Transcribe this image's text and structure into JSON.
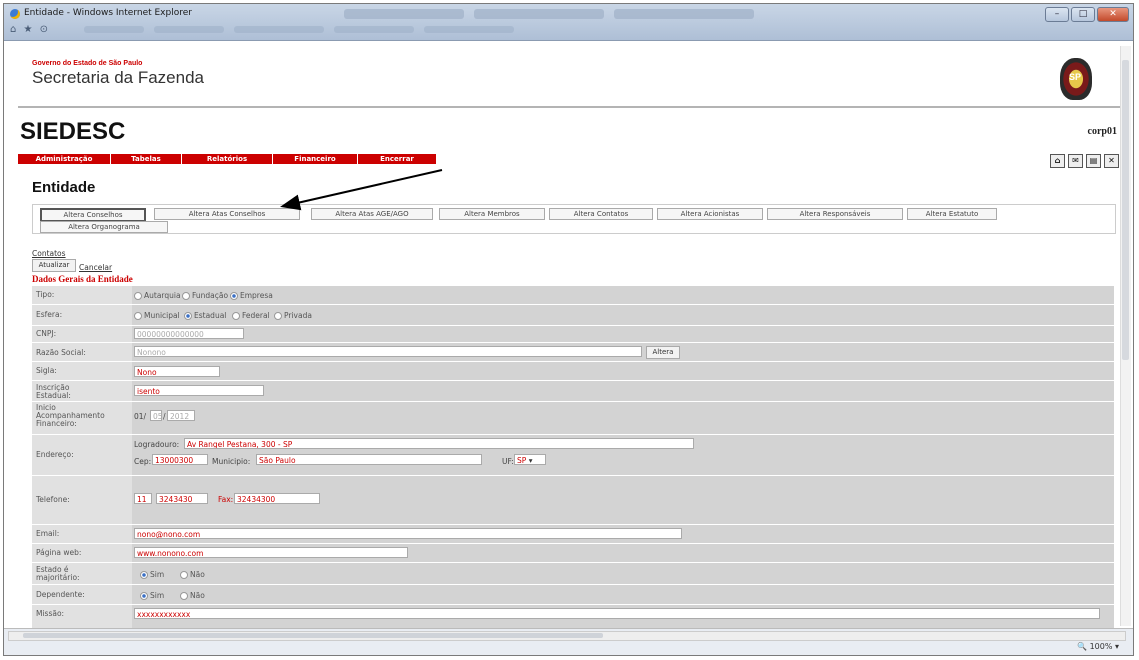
{
  "window": {
    "title": "Entidade - Windows Internet Explorer",
    "zoom": "100%"
  },
  "header": {
    "gov_line": "Governo do Estado de São Paulo",
    "dept": "Secretaria da Fazenda",
    "seal_text": "SP",
    "app": "SIEDESC",
    "user": "corp01"
  },
  "menu": [
    "Administração",
    "Tabelas",
    "Relatórios",
    "Financeiro",
    "Encerrar"
  ],
  "page_title": "Entidade",
  "tabs": [
    "Altera Conselhos",
    "Altera Atas Conselhos",
    "Altera Atas AGE/AGO",
    "Altera Membros",
    "Altera Contatos",
    "Altera Acionistas",
    "Altera Responsáveis",
    "Altera Estatuto",
    "Altera Organograma"
  ],
  "actions": {
    "contatos": "Contatos",
    "atualizar": "Atualizar",
    "cancelar": "Cancelar"
  },
  "section_title": "Dados Gerais da Entidade",
  "form": {
    "tipo": {
      "label": "Tipo:",
      "options": [
        "Autarquia",
        "Fundação",
        "Empresa"
      ],
      "selected": "Empresa"
    },
    "esfera": {
      "label": "Esfera:",
      "options": [
        "Municipal",
        "Estadual",
        "Federal",
        "Privada"
      ],
      "selected": "Estadual"
    },
    "cnpj": {
      "label": "CNPJ:",
      "value": "00000000000000"
    },
    "razao": {
      "label": "Razão Social:",
      "value": "Nonono",
      "button": "Altera"
    },
    "sigla": {
      "label": "Sigla:",
      "value": "Nono"
    },
    "inscricao": {
      "label": "Inscrição Estadual:",
      "value": "isento"
    },
    "inicio": {
      "label": "Inicio Acompanhamento Financeiro:",
      "day": "01",
      "month": "05",
      "year": "2012"
    },
    "endereco": {
      "label": "Endereço:",
      "logradouro_label": "Logradouro:",
      "logradouro": "Av Rangel Pestana, 300 - SP",
      "cep_label": "Cep:",
      "cep": "13000300",
      "municipio_label": "Municipio:",
      "municipio": "São Paulo",
      "uf_label": "UF:",
      "uf": "SP"
    },
    "telefone": {
      "label": "Telefone:",
      "ddd": "11",
      "numero": "3243430",
      "fax_label": "Fax:",
      "fax": "32434300"
    },
    "email": {
      "label": "Email:",
      "value": "nono@nono.com"
    },
    "pagina": {
      "label": "Página web:",
      "value": "www.nonono.com"
    },
    "estado_majoritario": {
      "label": "Estado é majoritário:",
      "options": [
        "Sim",
        "Não"
      ],
      "selected": "Sim"
    },
    "dependente": {
      "label": "Dependente:",
      "options": [
        "Sim",
        "Não"
      ],
      "selected": "Sim"
    },
    "missao": {
      "label": "Missão:",
      "value": "xxxxxxxxxxxx"
    }
  }
}
